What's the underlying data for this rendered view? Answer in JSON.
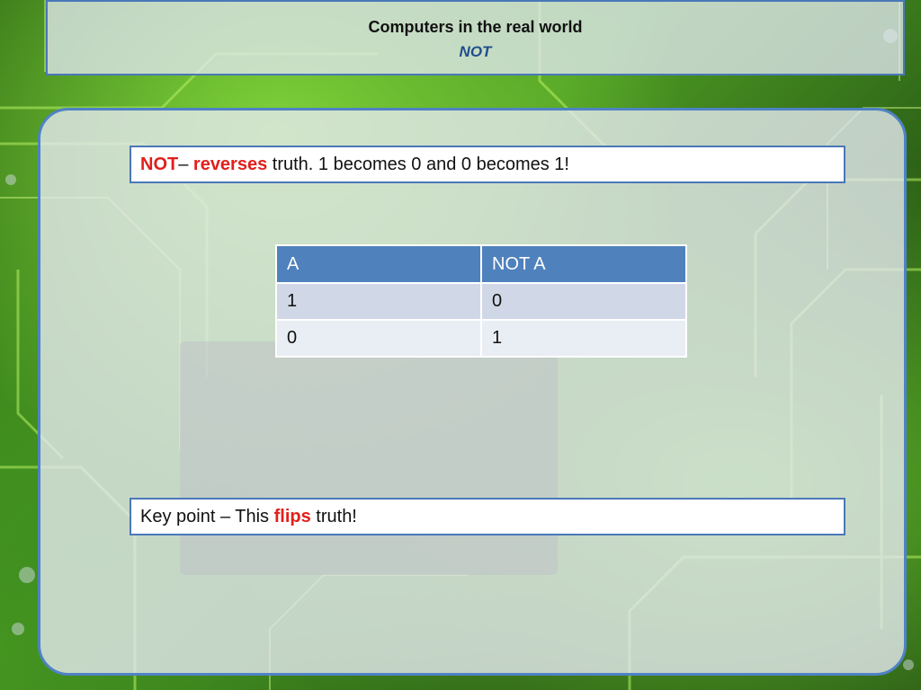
{
  "slide": {
    "title": "Computers in the real world",
    "subtitle": "NOT"
  },
  "callout_top": {
    "term": "NOT",
    "dash": "– ",
    "verb": "reverses",
    "rest": " truth. 1 becomes 0 and 0 becomes 1!"
  },
  "truth_table": {
    "headers": [
      "A",
      "NOT A"
    ],
    "rows": [
      [
        "1",
        "0"
      ],
      [
        "0",
        "1"
      ]
    ]
  },
  "callout_bottom": {
    "prefix": "Key point – This ",
    "emphasis": "flips",
    "suffix": " truth!"
  },
  "colors": {
    "accent_blue": "#4f81bd",
    "emphasis_red": "#e0201c",
    "border_blue": "#4a78b8"
  }
}
